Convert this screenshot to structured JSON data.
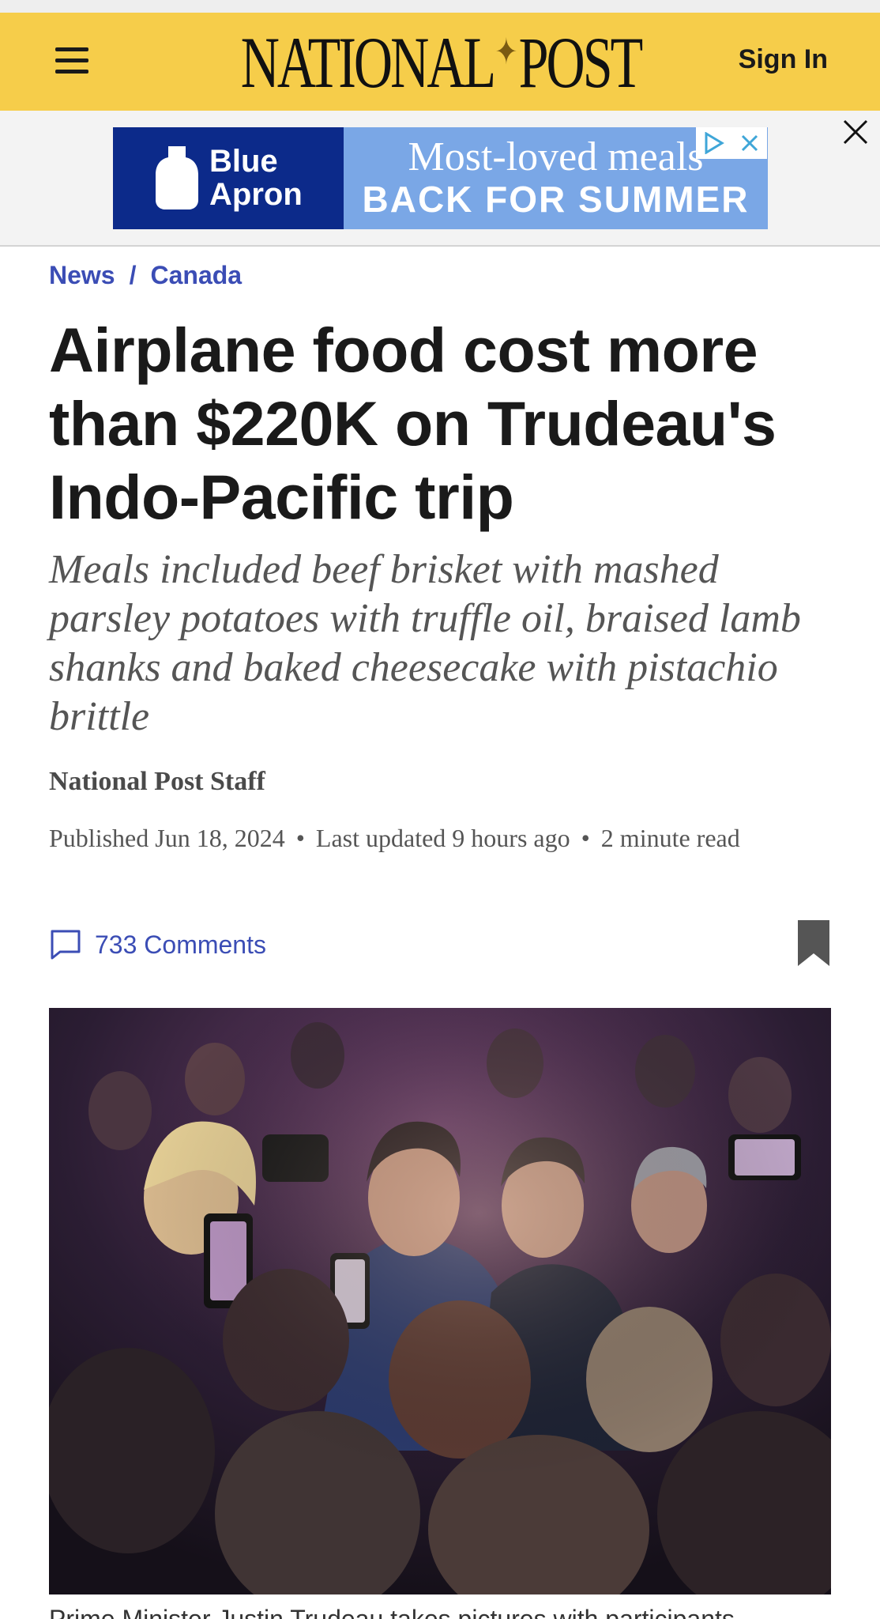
{
  "header": {
    "logo_left": "NATIONAL",
    "logo_right": "POST",
    "sign_in": "Sign In"
  },
  "ad": {
    "brand_line1": "Blue",
    "brand_line2": "Apron",
    "headline": "Most-loved meals",
    "subline": "BACK FOR SUMMER"
  },
  "breadcrumb": {
    "section": "News",
    "separator": "/",
    "subsection": "Canada"
  },
  "article": {
    "headline": "Airplane food cost more than $220K on Trudeau's Indo-Pacific trip",
    "dek": "Meals included beef brisket with mashed parsley potatoes with truffle oil, braised lamb shanks and baked cheesecake with pistachio brittle",
    "byline": "National Post Staff",
    "published": "Published Jun 18, 2024",
    "updated": "Last updated 9 hours ago",
    "read_time": "2 minute read",
    "meta_separator": "•",
    "comments": "733 Comments",
    "caption": "Prime Minister Justin Trudeau takes pictures with participants"
  },
  "colors": {
    "masthead": "#f6cd4a",
    "link": "#3b4db5",
    "ad_brand": "#0c2a8a"
  }
}
